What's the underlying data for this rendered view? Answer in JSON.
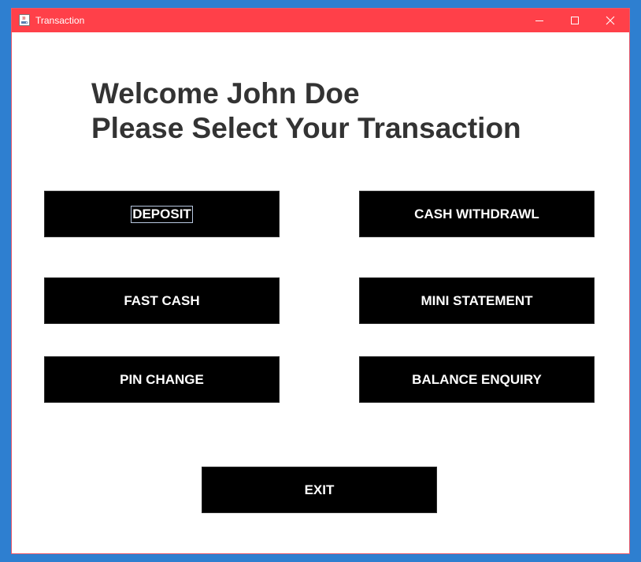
{
  "window": {
    "title": "Transaction",
    "titlebar_color": "#ff4049",
    "icon": "java-cup-icon"
  },
  "heading": {
    "line1": "Welcome John Doe",
    "line2": "Please Select Your Transaction"
  },
  "buttons": {
    "deposit": "DEPOSIT",
    "cash_withdrawl": "CASH WITHDRAWL",
    "fast_cash": "FAST CASH",
    "mini_statement": "MINI STATEMENT",
    "pin_change": "PIN CHANGE",
    "balance_enquiry": "BALANCE ENQUIRY",
    "exit": "EXIT"
  },
  "colors": {
    "button_bg": "#000000",
    "button_text": "#ffffff",
    "heading_text": "#333333"
  }
}
